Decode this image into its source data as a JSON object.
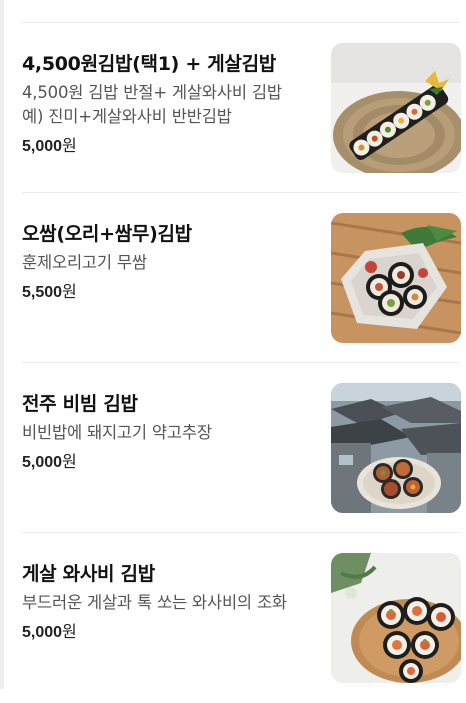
{
  "menu": {
    "items": [
      {
        "name": "4,500원김밥(택1) + 게살김밥",
        "description": "4,500원 김밥 반절+ 게살와사비 김밥 예) 진미+게살와사비 반반김밥",
        "price": "5,000",
        "currency": "원",
        "photo_icon": "kimbap-on-woven-plate-photo"
      },
      {
        "name": "오쌈(오리+쌈무)김밥",
        "description": "훈제오리고기 무쌈",
        "price": "5,500",
        "currency": "원",
        "photo_icon": "duck-ssam-kimbap-photo"
      },
      {
        "name": "전주 비빔 김밥",
        "description": "비빈밥에 돼지고기 약고추장",
        "price": "5,000",
        "currency": "원",
        "photo_icon": "jeonju-hanok-kimbap-photo"
      },
      {
        "name": "게살 와사비 김밥",
        "description": "부드러운 게살과 톡 쏘는 와사비의 조화",
        "price": "5,000",
        "currency": "원",
        "photo_icon": "crab-wasabi-kimbap-photo"
      }
    ]
  }
}
